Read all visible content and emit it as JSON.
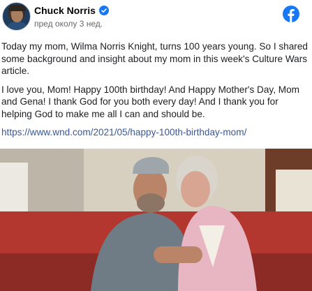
{
  "post": {
    "author": "Chuck Norris",
    "timestamp": "пред околу 3 нед.",
    "paragraphs": [
      "Today my mom, Wilma Norris Knight, turns 100 years young. So I shared some background and insight about my mom in this week's Culture Wars article.",
      "I love you, Mom! Happy 100th birthday! And Happy Mother's Day, Mom and Gena! I thank God for you both every day! And I thank you for helping God to make me all I can and should be."
    ],
    "link": "https://www.wnd.com/2021/05/happy-100th-birthday-mom/"
  },
  "icons": {
    "verified": "verified-badge-icon",
    "facebook": "facebook-logo-icon"
  },
  "colors": {
    "brand": "#1877f2",
    "link": "#385898",
    "muted": "#65676b"
  }
}
